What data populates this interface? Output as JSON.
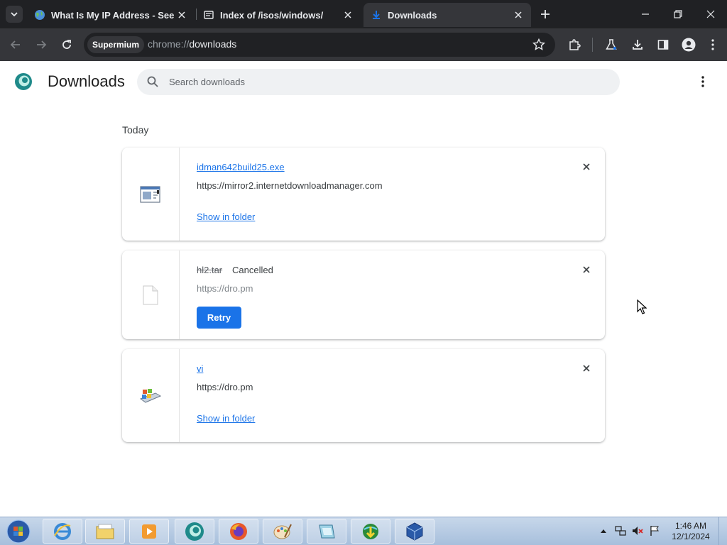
{
  "browser": {
    "tabs": [
      {
        "title": "What Is My IP Address - See Y",
        "active": false
      },
      {
        "title": "Index of /isos/windows/",
        "active": false
      },
      {
        "title": "Downloads",
        "active": true
      }
    ],
    "omnibox": {
      "chip": "Supermium",
      "scheme": "chrome://",
      "host": "downloads"
    },
    "colors": {
      "tabstrip": "#202124",
      "toolbar": "#35363a",
      "accent": "#1a73e8"
    }
  },
  "page": {
    "title": "Downloads",
    "search_placeholder": "Search downloads",
    "section": "Today"
  },
  "downloads": [
    {
      "filename": "idman642build25.exe",
      "source": "https://mirror2.internetdownloadmanager.com",
      "action": "Show in folder",
      "status": "",
      "icon": "installer-icon"
    },
    {
      "filename": "hl2.tar",
      "source": "https://dro.pm",
      "action": "Retry",
      "status": "Cancelled",
      "icon": "blank-file-icon"
    },
    {
      "filename": "vi",
      "source": "https://dro.pm",
      "action": "Show in folder",
      "status": "",
      "icon": "windows-app-icon"
    }
  ],
  "taskbar": {
    "apps": [
      "internet-explorer-icon",
      "file-explorer-icon",
      "media-player-icon",
      "supermium-icon",
      "firefox-icon",
      "paint-icon",
      "virtual-pc-icon",
      "idm-icon",
      "virtualbox-icon"
    ],
    "clock": {
      "time": "1:46 AM",
      "date": "12/1/2024"
    }
  }
}
